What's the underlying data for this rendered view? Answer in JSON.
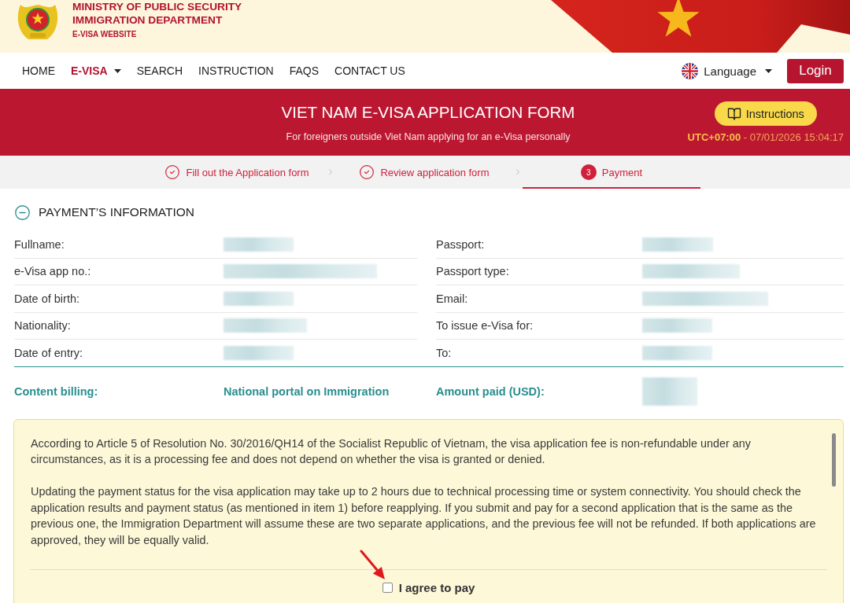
{
  "header": {
    "lines": [
      "MINISTRY OF PUBLIC SECURITY",
      "IMMIGRATION DEPARTMENT"
    ],
    "subtitle": "E-VISA WEBSITE"
  },
  "nav": {
    "items": [
      {
        "label": "HOME",
        "selected": false,
        "dropdown": false
      },
      {
        "label": "E-VISA",
        "selected": true,
        "dropdown": true
      },
      {
        "label": "SEARCH",
        "selected": false,
        "dropdown": false
      },
      {
        "label": "INSTRUCTION",
        "selected": false,
        "dropdown": false
      },
      {
        "label": "FAQS",
        "selected": false,
        "dropdown": false
      },
      {
        "label": "CONTACT US",
        "selected": false,
        "dropdown": false
      }
    ],
    "language": "Language",
    "login": "Login"
  },
  "banner": {
    "title": "VIET NAM E-VISA APPLICATION FORM",
    "subtitle": "For foreigners outside Viet Nam applying for an e-Visa personally",
    "instructions_button": "Instructions",
    "time": "**UTC+07:00** - 07/01/2026 15:04:17"
  },
  "steps": [
    {
      "label": "Fill out the Application form",
      "done": true,
      "selected": false
    },
    {
      "label": "Review application form",
      "done": true,
      "selected": false
    },
    {
      "label": "Payment",
      "number": "3",
      "done": false,
      "selected": true
    }
  ],
  "payment_info": {
    "title": "PAYMENT’S INFORMATION",
    "expanded": true,
    "rows": [
      {
        "fields": [
          {
            "label": "Fullname:",
            "redacted": true
          },
          {
            "label": "Passport:",
            "redacted": true
          }
        ]
      },
      {
        "fields": [
          {
            "label": "e-Visa app no.:",
            "redacted": true
          },
          {
            "label": "Passport type:",
            "redacted": true
          }
        ]
      },
      {
        "fields": [
          {
            "label": "Date of birth:",
            "redacted": true
          },
          {
            "label": "Email:",
            "redacted": true
          }
        ]
      },
      {
        "fields": [
          {
            "label": "Nationality:",
            "redacted": true
          },
          {
            "label": "To issue e-Visa for:",
            "redacted": true
          }
        ]
      },
      {
        "fields": [
          {
            "label": "Date of entry:",
            "redacted": true
          },
          {
            "label": "To:",
            "redacted": true
          }
        ]
      }
    ],
    "billing": [
      {
        "label": "Content billing:",
        "value": "National portal on Immigration"
      },
      {
        "label": "Amount paid (USD):",
        "redacted": true
      }
    ]
  },
  "notice": {
    "paragraphs": [
      "According to Article 5 of Resolution No. 30/2016/QH14 of the Socialist Republic of Vietnam, the visa application fee is non-refundable under any circumstances, as it is a processing fee and does not depend on whether the visa is granted or denied.",
      "Updating the payment status for the visa application may take up to 2 hours due to technical processing time or system connectivity. You should check the application results and payment status (as mentioned in item 1) before reapplying. If you submit and pay for a second application that is the same as the previous one, the Immigration Department will assume these are two separate applications, and the previous fee will not be refunded. If both applications are approved, they will be equally valid."
    ],
    "agree": {
      "label": "I agree to pay",
      "checked": false
    }
  }
}
